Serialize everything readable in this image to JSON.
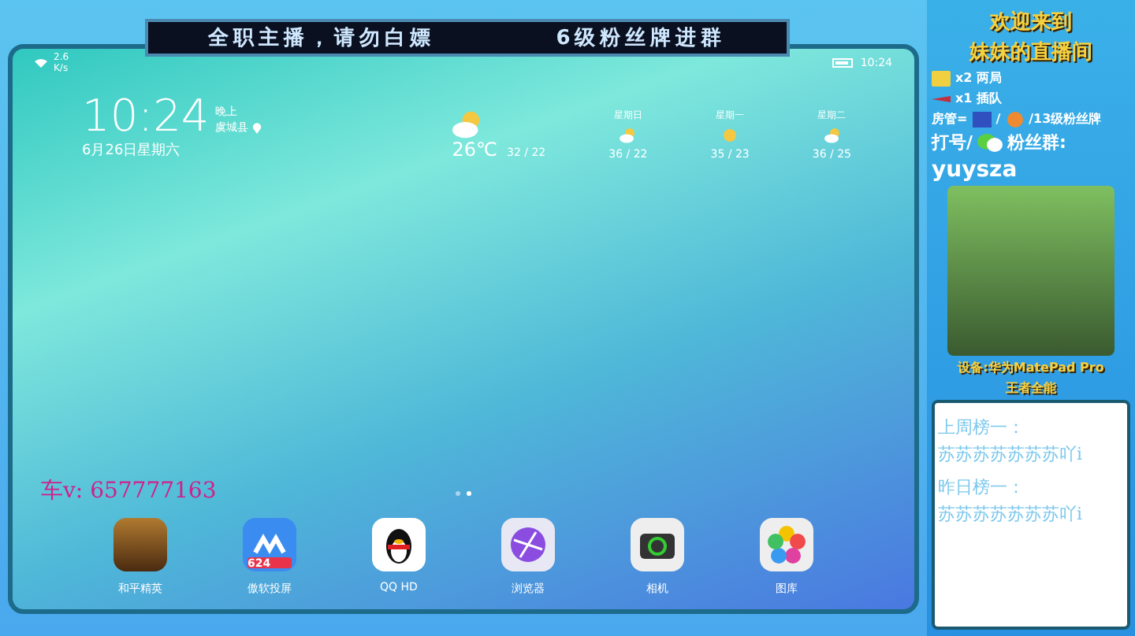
{
  "banner": {
    "text": "全职主播，请勿白嫖",
    "text2": "6级粉丝牌进群"
  },
  "tablet": {
    "status_bar": {
      "speed": "2.6",
      "speed_unit": "K/s",
      "time": "10:24"
    },
    "clock": {
      "time": "10:24",
      "period": "晚上",
      "location": "虞城县",
      "date": "6月26日星期六"
    },
    "weather": {
      "temp": "26℃",
      "range": "32 / 22",
      "forecast": [
        {
          "day": "星期日",
          "range": "36 / 22",
          "kind": "cloudy"
        },
        {
          "day": "星期一",
          "range": "35 / 23",
          "kind": "sunny"
        },
        {
          "day": "星期二",
          "range": "36 / 25",
          "kind": "cloudy"
        }
      ]
    },
    "page_dots": [
      {
        "selected": false
      },
      {
        "selected": true
      }
    ],
    "dock": [
      {
        "label": "和平精英",
        "kind": "game"
      },
      {
        "label": "傲软投屏",
        "kind": "cast",
        "badge": "624"
      },
      {
        "label": "QQ HD",
        "kind": "qq"
      },
      {
        "label": "浏览器",
        "kind": "browser"
      },
      {
        "label": "相机",
        "kind": "camera"
      },
      {
        "label": "图库",
        "kind": "gallery"
      }
    ],
    "overlay_text": "车v: 657777163"
  },
  "panel": {
    "title": [
      "欢迎来到",
      "妹妹的直播间"
    ],
    "rules": [
      {
        "kind": "bar",
        "text": "x2 两局"
      },
      {
        "kind": "plane",
        "text": "x1 插队"
      }
    ],
    "admin": {
      "prefix": "房管=",
      "sep": "/",
      "suffix": "/13级粉丝牌"
    },
    "group": {
      "prefix": "打号/",
      "suffix": "粉丝群:",
      "id": "yuysza"
    },
    "device": [
      "设备:华为MatePad Pro",
      "王者全能"
    ],
    "board": [
      {
        "heading": "上周榜一：",
        "name": "苏苏苏苏苏苏苏吖i"
      },
      {
        "heading": "昨日榜一：",
        "name": "苏苏苏苏苏苏苏吖i"
      }
    ]
  }
}
